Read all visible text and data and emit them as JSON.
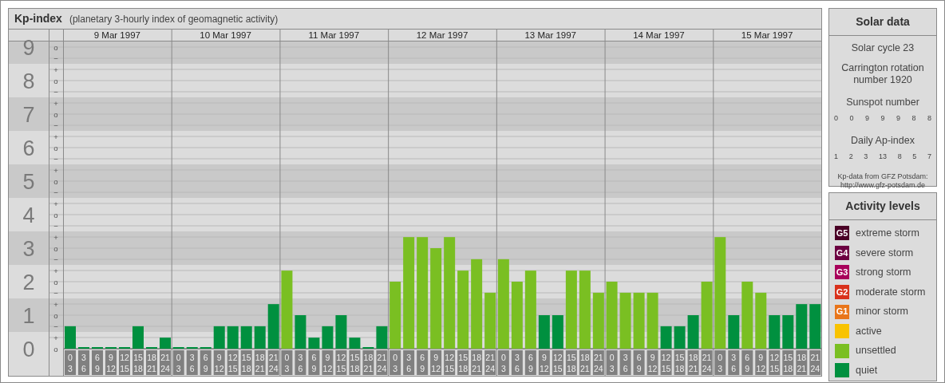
{
  "title": "Kp-index",
  "subtitle": "(planetary 3-hourly index of geomagnetic activity)",
  "days": [
    {
      "date": "9 Mar 1997"
    },
    {
      "date": "10 Mar 1997"
    },
    {
      "date": "11 Mar 1997"
    },
    {
      "date": "12 Mar 1997"
    },
    {
      "date": "13 Mar 1997"
    },
    {
      "date": "14 Mar 1997"
    },
    {
      "date": "15 Mar 1997"
    }
  ],
  "scale_marks": [
    {
      "marks": [
        {
          "mark": "o",
          "kind": "middle"
        },
        {
          "mark": "−",
          "kind": "lower"
        }
      ]
    },
    {
      "marks": [
        {
          "mark": "+",
          "kind": "upper"
        },
        {
          "mark": "o",
          "kind": "middle"
        },
        {
          "mark": "−",
          "kind": "lower"
        }
      ]
    },
    {
      "marks": [
        {
          "mark": "+",
          "kind": "upper"
        },
        {
          "mark": "o",
          "kind": "middle"
        },
        {
          "mark": "−",
          "kind": "lower"
        }
      ]
    },
    {
      "marks": [
        {
          "mark": "+",
          "kind": "upper"
        },
        {
          "mark": "o",
          "kind": "middle"
        },
        {
          "mark": "−",
          "kind": "lower"
        }
      ]
    },
    {
      "marks": [
        {
          "mark": "+",
          "kind": "upper"
        },
        {
          "mark": "o",
          "kind": "middle"
        },
        {
          "mark": "−",
          "kind": "lower"
        }
      ]
    },
    {
      "marks": [
        {
          "mark": "+",
          "kind": "upper"
        },
        {
          "mark": "o",
          "kind": "middle"
        },
        {
          "mark": "−",
          "kind": "lower"
        }
      ]
    },
    {
      "marks": [
        {
          "mark": "+",
          "kind": "upper"
        },
        {
          "mark": "o",
          "kind": "middle"
        },
        {
          "mark": "−",
          "kind": "lower"
        }
      ]
    },
    {
      "marks": [
        {
          "mark": "+",
          "kind": "upper"
        },
        {
          "mark": "o",
          "kind": "middle"
        },
        {
          "mark": "−",
          "kind": "lower"
        }
      ]
    },
    {
      "marks": [
        {
          "mark": "+",
          "kind": "upper"
        },
        {
          "mark": "o",
          "kind": "middle"
        },
        {
          "mark": "−",
          "kind": "lower"
        }
      ]
    },
    {
      "marks": [
        {
          "mark": "+",
          "kind": "upper"
        },
        {
          "mark": "o",
          "kind": "middle"
        }
      ]
    }
  ],
  "chart_data": {
    "type": "bar",
    "grid": true,
    "ylim": [
      0,
      9
    ],
    "yticks": [
      0,
      1,
      2,
      3,
      4,
      5,
      6,
      7,
      8,
      9
    ],
    "categories": [
      "0 3",
      "3 6",
      "6 9",
      "9 12",
      "12 15",
      "15 18",
      "18 21",
      "21 24",
      "0 3",
      "3 6",
      "6 9",
      "9 12",
      "12 15",
      "15 18",
      "18 21",
      "21 24",
      "0 3",
      "3 6",
      "6 9",
      "9 12",
      "12 15",
      "15 18",
      "18 21",
      "21 24",
      "0 3",
      "3 6",
      "6 9",
      "9 12",
      "12 15",
      "15 18",
      "18 21",
      "21 24",
      "0 3",
      "3 6",
      "6 9",
      "9 12",
      "12 15",
      "15 18",
      "18 21",
      "21 24",
      "0 3",
      "3 6",
      "6 9",
      "9 12",
      "12 15",
      "15 18",
      "18 21",
      "21 24",
      "0 3",
      "3 6",
      "6 9",
      "9 12",
      "12 15",
      "15 18",
      "18 21",
      "21 24"
    ],
    "series": [
      {
        "color": "#00903f",
        "values": [
          0.67,
          0,
          0,
          0,
          0,
          0.67,
          0,
          0.33,
          0,
          0,
          0,
          0.67,
          0.67,
          0.67,
          0.67,
          1.33,
          null,
          1,
          0.33,
          0.67,
          1,
          0.33,
          0,
          0.67,
          null,
          null,
          null,
          null,
          null,
          null,
          null,
          null,
          null,
          null,
          null,
          1,
          1,
          null,
          null,
          null,
          null,
          null,
          null,
          null,
          0.67,
          0.67,
          1,
          null,
          null,
          1,
          null,
          null,
          1,
          1,
          1.33,
          1.33
        ]
      },
      {
        "color": "#7abf22",
        "values": [
          null,
          null,
          null,
          null,
          null,
          null,
          null,
          null,
          null,
          null,
          null,
          null,
          null,
          null,
          null,
          null,
          2.33,
          null,
          null,
          null,
          null,
          null,
          null,
          null,
          2,
          3.33,
          3.33,
          3,
          3.33,
          2.33,
          2.67,
          1.67,
          2.67,
          2,
          2.33,
          null,
          null,
          2.33,
          2.33,
          1.67,
          2,
          1.67,
          1.67,
          1.67,
          null,
          null,
          null,
          2,
          3.33,
          null,
          2,
          1.67,
          null,
          null,
          null,
          null
        ]
      }
    ]
  },
  "solar": {
    "title": "Solar data",
    "cycle": "Solar cycle 23",
    "rotation": "Carrington rotation number 1920",
    "sunspot_title": "Sunspot number",
    "sunspots": [
      "0",
      "0",
      "9",
      "9",
      "9",
      "8",
      "8"
    ],
    "ap_title": "Daily Ap-index",
    "ap": [
      "1",
      "2",
      "3",
      "13",
      "8",
      "5",
      "7"
    ],
    "source": "Kp-data from GFZ Potsdam:",
    "source_url": "http://www.gfz-potsdam.de"
  },
  "legend": {
    "title": "Activity levels",
    "items": [
      {
        "badge": "G5",
        "label": "extreme storm",
        "color": "#4a0026"
      },
      {
        "badge": "G4",
        "label": "severe storm",
        "color": "#6c0041"
      },
      {
        "badge": "G3",
        "label": "strong storm",
        "color": "#a8005a"
      },
      {
        "badge": "G2",
        "label": "moderate storm",
        "color": "#d9321c"
      },
      {
        "badge": "G1",
        "label": "minor storm",
        "color": "#e9761b"
      },
      {
        "label": "active",
        "color": "#f8c300"
      },
      {
        "label": "unsettled",
        "color": "#7abf22"
      },
      {
        "label": "quiet",
        "color": "#00903f"
      }
    ]
  }
}
